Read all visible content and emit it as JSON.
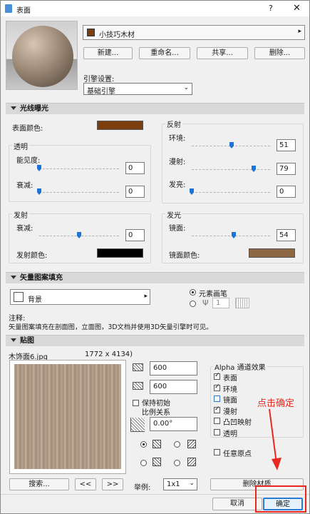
{
  "window": {
    "title": "表面",
    "help": "?",
    "close": "✕"
  },
  "material": {
    "name": "小技巧木材",
    "name_color": "#7b3f0f"
  },
  "buttons": {
    "new": "新建...",
    "rename": "重命名...",
    "share": "共享...",
    "delete": "删除..."
  },
  "engine": {
    "label": "引擎设置:",
    "value": "基础引擎"
  },
  "section_light": {
    "title": "光线曝光"
  },
  "surface_color": {
    "label": "表面颜色:",
    "color": "#7b3f0f"
  },
  "transparency": {
    "title": "透明",
    "visibility": {
      "label": "能见度:",
      "value": "0",
      "fraction": 0.0
    },
    "attenuation": {
      "label": "衰减:",
      "value": "0",
      "fraction": 0.0
    }
  },
  "reflection": {
    "title": "反射",
    "ambient": {
      "label": "环境:",
      "value": "51",
      "fraction": 0.51
    },
    "diffuse": {
      "label": "漫射:",
      "value": "79",
      "fraction": 0.79
    },
    "specular": {
      "label": "发亮:",
      "value": "0",
      "fraction": 0.0
    }
  },
  "emission": {
    "title": "发射",
    "attenuation": {
      "label": "衰减:",
      "value": "0",
      "fraction": 0.5
    },
    "color_label": "发射颜色:",
    "color": "#000000"
  },
  "glow": {
    "title": "发光",
    "mirror": {
      "label": "镜面:",
      "value": "54",
      "fraction": 0.54
    },
    "color_label": "镜面颜色:",
    "color": "#8b6743"
  },
  "section_vector": {
    "title": "矢量图案填充"
  },
  "fill": {
    "label": "背景",
    "element_pen": "元素画笔",
    "pen_number": "1"
  },
  "note": {
    "line1": "注释:",
    "line2": "矢量图案填充在剖面图，立面图，3D文档并使用3D矢量引擎时可见。"
  },
  "section_texture": {
    "title": "贴图"
  },
  "texture": {
    "filename": "木饰面6.jpg",
    "dimensions": "1772 x 4134)",
    "width": "600",
    "height": "600",
    "keep_ratio_line1": "保持初始",
    "keep_ratio_line2": "比例关系",
    "angle": "0.00°"
  },
  "alpha": {
    "title": "Alpha 通道效果",
    "items": [
      {
        "label": "表面",
        "checked": true
      },
      {
        "label": "环境",
        "checked": true
      },
      {
        "label": "镜面",
        "checked": false
      },
      {
        "label": "漫射",
        "checked": true
      },
      {
        "label": "凸凹映射",
        "checked": false
      },
      {
        "label": "透明",
        "checked": false
      }
    ]
  },
  "random_origin": "任意原点",
  "search_button": "搜索...",
  "prev_button": "<<",
  "next_button": ">>",
  "scale": {
    "label": "举例:",
    "value": "1x1"
  },
  "delete_texture": "删除材质",
  "annotation": {
    "text": "点击确定",
    "color": "#e8281e"
  },
  "footer": {
    "cancel": "取消",
    "ok": "确定"
  }
}
